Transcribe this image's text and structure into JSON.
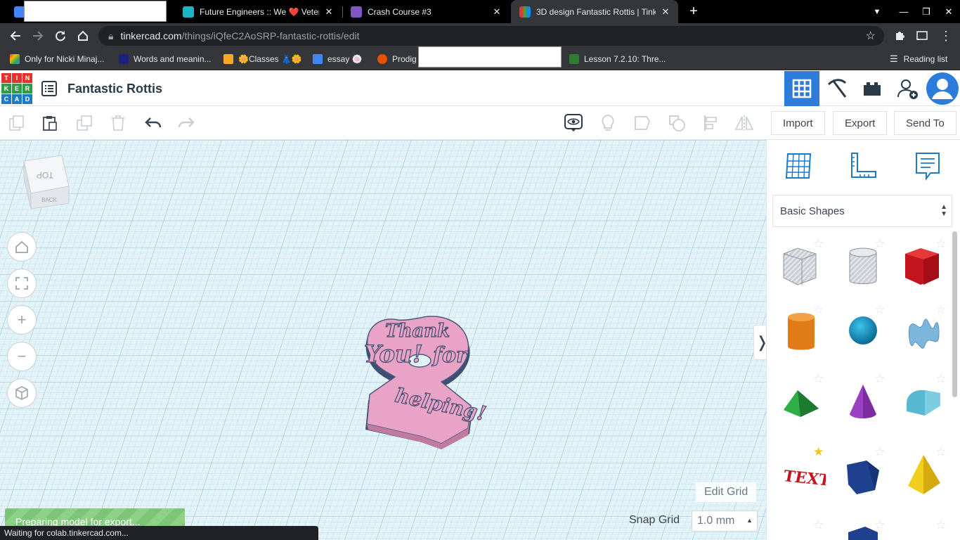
{
  "browser": {
    "tabs": [
      {
        "title": "",
        "active": false
      },
      {
        "title": "Future Engineers :: We ❤️ Vetera",
        "active": false
      },
      {
        "title": "Crash Course #3",
        "active": false
      },
      {
        "title": "3D design Fantastic Rottis | Tink",
        "active": true
      }
    ],
    "url_host": "tinkercad.com",
    "url_path": "/things/iQfeC2AoSRP-fantastic-rottis/edit",
    "bookmarks": [
      {
        "label": "Only for Nicki Minaj..."
      },
      {
        "label": "Words and meanin..."
      },
      {
        "label": "🌼Classes 👗🌼"
      },
      {
        "label": "essay 🍥"
      },
      {
        "label": "Prodig"
      },
      {
        "label": "Lesson 7.2.10: Thre..."
      }
    ],
    "reading_list": "Reading list"
  },
  "app": {
    "logo_letters": [
      "TIN",
      "KER",
      "CAD"
    ],
    "design_title": "Fantastic Rottis"
  },
  "toolbar": {
    "import_label": "Import",
    "export_label": "Export",
    "send_to_label": "Send To"
  },
  "workplane": {
    "viewcube_top": "TOP",
    "viewcube_back": "BACK",
    "edit_grid_label": "Edit Grid",
    "snap_grid_label": "Snap Grid",
    "snap_grid_value": "1.0 mm",
    "export_progress_text": "Preparing model for export...",
    "model_text": [
      "Thank",
      "You!",
      "for",
      "helping!"
    ]
  },
  "panel": {
    "category": "Basic Shapes",
    "shapes": [
      {
        "name": "Box (hole)",
        "favorite": false
      },
      {
        "name": "Cylinder (hole)",
        "favorite": false
      },
      {
        "name": "Box",
        "favorite": false
      },
      {
        "name": "Cylinder",
        "favorite": false
      },
      {
        "name": "Sphere",
        "favorite": false
      },
      {
        "name": "Scribble",
        "favorite": false
      },
      {
        "name": "Roof",
        "favorite": false
      },
      {
        "name": "Cone",
        "favorite": false
      },
      {
        "name": "Round Roof",
        "favorite": false
      },
      {
        "name": "Text",
        "favorite": true
      },
      {
        "name": "Polygon",
        "favorite": false
      },
      {
        "name": "Pyramid",
        "favorite": false
      }
    ]
  },
  "status": {
    "text": "Waiting for colab.tinkercad.com..."
  }
}
